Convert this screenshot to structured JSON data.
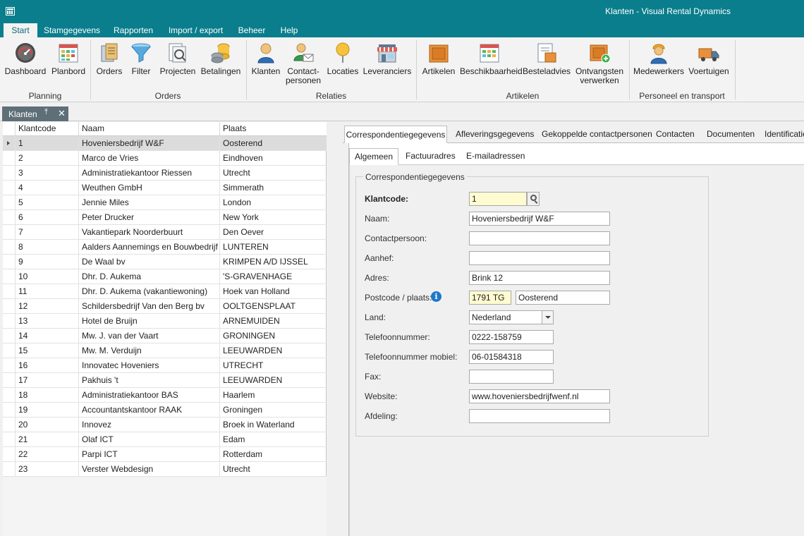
{
  "window": {
    "title": "Klanten - Visual Rental Dynamics"
  },
  "menu": {
    "tabs": [
      "Start",
      "Stamgegevens",
      "Rapporten",
      "Import / export",
      "Beheer",
      "Help"
    ]
  },
  "ribbon": {
    "buttons": [
      {
        "label": "Dashboard",
        "icon": "dashboard-gauge-icon"
      },
      {
        "label": "Planbord",
        "icon": "calendar-grid-icon"
      },
      {
        "label": "Orders",
        "icon": "orders-clipboard-icon"
      },
      {
        "label": "Filter",
        "icon": "funnel-icon"
      },
      {
        "label": "Projecten",
        "icon": "projects-icon"
      },
      {
        "label": "Betalingen",
        "icon": "coins-icon"
      },
      {
        "label": "Klanten",
        "icon": "person-icon"
      },
      {
        "label": "Contact-\npersonen",
        "icon": "contact-mail-icon"
      },
      {
        "label": "Locaties",
        "icon": "location-pin-icon"
      },
      {
        "label": "Leveranciers",
        "icon": "shop-icon"
      },
      {
        "label": "Artikelen",
        "icon": "box-icon"
      },
      {
        "label": "Beschikbaarheid",
        "icon": "availability-calendar-icon"
      },
      {
        "label": "Besteladvies",
        "icon": "order-advice-icon"
      },
      {
        "label": "Ontvangsten\nverwerken",
        "icon": "receive-box-icon"
      },
      {
        "label": "Medewerkers",
        "icon": "worker-icon"
      },
      {
        "label": "Voertuigen",
        "icon": "truck-icon"
      }
    ],
    "groups": [
      "Planning",
      "Orders",
      "Relaties",
      "Artikelen",
      "Personeel en transport"
    ]
  },
  "doc_tab": {
    "label": "Klanten"
  },
  "grid": {
    "columns": [
      "Klantcode",
      "Naam",
      "Plaats"
    ],
    "rows": [
      [
        "1",
        "Hoveniersbedrijf W&F",
        "Oosterend"
      ],
      [
        "2",
        "Marco de Vries",
        "Eindhoven"
      ],
      [
        "3",
        "Administratiekantoor Riessen",
        "Utrecht"
      ],
      [
        "4",
        "Weuthen GmbH",
        "Simmerath"
      ],
      [
        "5",
        "Jennie Miles",
        "London"
      ],
      [
        "6",
        "Peter Drucker",
        "New York"
      ],
      [
        "7",
        "Vakantiepark Noorderbuurt",
        "Den Oever"
      ],
      [
        "8",
        "Aalders  Aannemings en Bouwbedrijf",
        "LUNTEREN"
      ],
      [
        "9",
        "De Waal bv",
        "KRIMPEN A/D IJSSEL"
      ],
      [
        "10",
        "Dhr. D. Aukema",
        "'S-GRAVENHAGE"
      ],
      [
        "11",
        "Dhr. D. Aukema (vakantiewoning)",
        "Hoek van Holland"
      ],
      [
        "12",
        "Schildersbedrijf Van den Berg bv",
        "OOLTGENSPLAAT"
      ],
      [
        "13",
        "Hotel de Bruijn",
        "ARNEMUIDEN"
      ],
      [
        "14",
        "Mw. J. van der Vaart",
        "GRONINGEN"
      ],
      [
        "15",
        "Mw. M. Verduijn",
        "LEEUWARDEN"
      ],
      [
        "16",
        "Innovatec Hoveniers",
        "UTRECHT"
      ],
      [
        "17",
        "Pakhuis 't",
        "LEEUWARDEN"
      ],
      [
        "18",
        "Administratiekantoor BAS",
        "Haarlem"
      ],
      [
        "19",
        "Accountantskantoor RAAK",
        "Groningen"
      ],
      [
        "20",
        "Innovez",
        "Broek in Waterland"
      ],
      [
        "21",
        "Olaf ICT",
        "Edam"
      ],
      [
        "22",
        "Parpi ICT",
        "Rotterdam"
      ],
      [
        "23",
        "Verster Webdesign",
        "Utrecht"
      ]
    ]
  },
  "detail": {
    "tabs": [
      "Correspondentiegegevens",
      "Afleveringsgegevens",
      "Gekoppelde contactpersonen",
      "Contacten",
      "Documenten",
      "Identificaties"
    ],
    "subtabs": [
      "Algemeen",
      "Factuuradres",
      "E-mailadressen"
    ],
    "group_title": "Correspondentiegegevens",
    "labels": {
      "klantcode": "Klantcode:",
      "naam": "Naam:",
      "contactpersoon": "Contactpersoon:",
      "aanhef": "Aanhef:",
      "adres": "Adres:",
      "postcode": "Postcode / plaats:",
      "land": "Land:",
      "telefoon": "Telefoonnummer:",
      "mobiel": "Telefoonnummer mobiel:",
      "fax": "Fax:",
      "website": "Website:",
      "afdeling": "Afdeling:"
    },
    "values": {
      "klantcode": "1",
      "naam": "Hoveniersbedrijf W&F",
      "contactpersoon": "",
      "aanhef": "",
      "adres": "Brink 12",
      "postcode": "1791 TG",
      "plaats": "Oosterend",
      "land": "Nederland",
      "telefoon": "0222-158759",
      "mobiel": "06-01584318",
      "fax": "",
      "website": "www.hoveniersbedrijfwenf.nl",
      "afdeling": ""
    }
  }
}
